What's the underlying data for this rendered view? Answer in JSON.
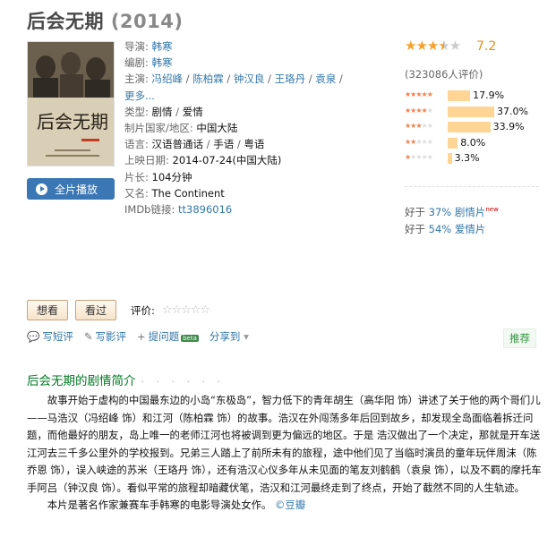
{
  "title": "后会无期",
  "year": "(2014)",
  "info": {
    "director_label": "导演",
    "director": "韩寒",
    "writer_label": "编剧",
    "writer": "韩寒",
    "cast_label": "主演",
    "cast": [
      "冯绍峰",
      "陈柏霖",
      "钟汉良",
      "王珞丹",
      "袁泉"
    ],
    "more": "更多...",
    "genre_label": "类型:",
    "genres": [
      "剧情",
      "爱情"
    ],
    "country_label": "制片国家/地区:",
    "country": "中国大陆",
    "language_label": "语言:",
    "languages": [
      "汉语普通话",
      "手语",
      "粤语"
    ],
    "release_label": "上映日期:",
    "release": "2014-07-24(中国大陆)",
    "runtime_label": "片长:",
    "runtime": "104分钟",
    "aka_label": "又名:",
    "aka": "The Continent",
    "imdb_label": "IMDb链接:",
    "imdb": "tt3896016"
  },
  "play_button": "全片播放",
  "rating": {
    "score": "7.2",
    "stars_value": 3.5,
    "votes": "(323086人评价)",
    "distribution": [
      {
        "stars": 5,
        "pct": "17.9%",
        "value": 17.9
      },
      {
        "stars": 4,
        "pct": "37.0%",
        "value": 37.0
      },
      {
        "stars": 3,
        "pct": "33.9%",
        "value": 33.9
      },
      {
        "stars": 2,
        "pct": "8.0%",
        "value": 8.0
      },
      {
        "stars": 1,
        "pct": "3.3%",
        "value": 3.3
      }
    ],
    "accent_color": "#f6a12a",
    "bar_color": "#ffd596"
  },
  "better_than": [
    {
      "prefix": "好于",
      "pct": "37%",
      "genre": "剧情片",
      "badge": "new"
    },
    {
      "prefix": "好于",
      "pct": "54%",
      "genre": "爱情片",
      "badge": ""
    }
  ],
  "actions": {
    "want": "想看",
    "seen": "看过",
    "rate_label": "评价:"
  },
  "links": {
    "short_review": "写短评",
    "review": "写影评",
    "ask": "提问题",
    "beta": "beta",
    "share": "分享到",
    "recommend": "推荐"
  },
  "synopsis": {
    "title": "后会无期的剧情简介",
    "dots": "· · · · · ·",
    "paragraph1": "故事开始于虚构的中国最东边的小岛“东极岛”，智力低下的青年胡生（高华阳 饰）讲述了关于他的两个哥们儿——马浩汉（冯绍峰 饰）和江河（陈柏霖 饰）的故事。浩汉在外闯荡多年后回到故乡，却发现全岛面临着拆迁问题，而他最好的朋友，岛上唯一的老师江河也将被调到更为偏远的地区。于是 浩汉做出了一个决定，那就是开车送江河去三千多公里外的学校报到。兄弟三人踏上了前所未有的旅程，途中他们见了当临时演员的童年玩伴周沫（陈乔恩 饰），误入峡途的苏米（王珞丹 饰），还有浩汉心仪多年从未见面的笔友刘鹤鹤（袁泉 饰），以及不羁的摩托车手阿吕（钟汉良 饰）。看似平常的旅程却暗藏伏笔，浩汉和江河最终走到了终点，开始了截然不同的人生轨迹。",
    "paragraph2": "本片是著名作家兼赛车手韩寒的电影导演处女作。",
    "source": "©豆瓣"
  }
}
